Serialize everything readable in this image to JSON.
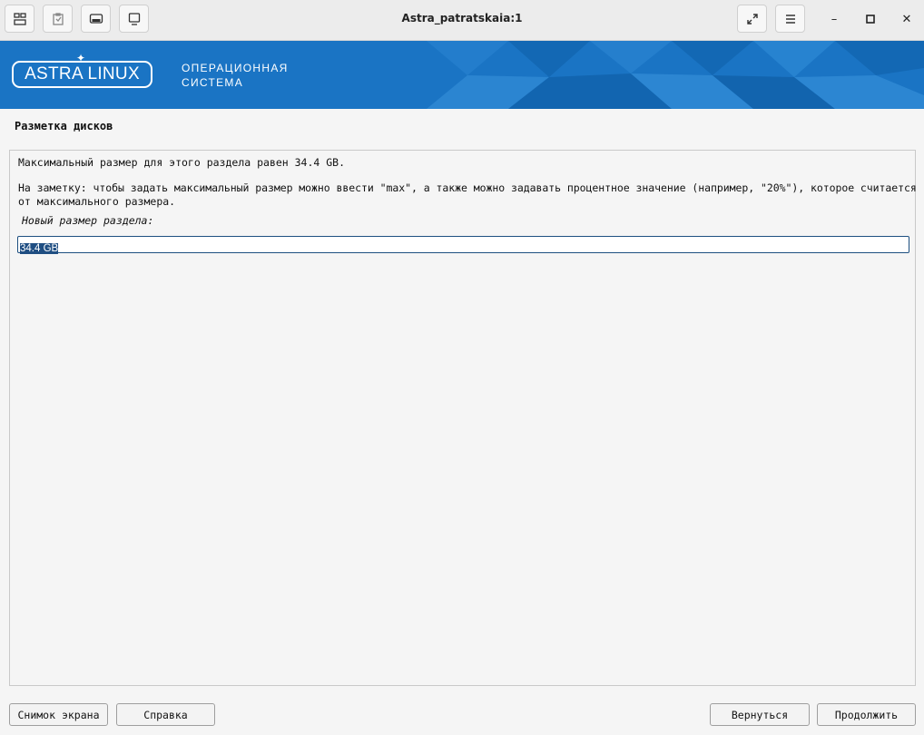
{
  "window": {
    "title": "Astra_patratskaia:1"
  },
  "toolbar": {
    "buttons": [
      {
        "icon": "windows-icon"
      },
      {
        "icon": "clipboard-icon"
      },
      {
        "icon": "keyboard-icon"
      },
      {
        "icon": "monitor-icon"
      }
    ],
    "right_buttons": [
      {
        "icon": "fullscreen-icon"
      },
      {
        "icon": "menu-icon"
      }
    ],
    "controls": {
      "minimize": "–",
      "maximize": "▫",
      "close": "✕"
    }
  },
  "banner": {
    "logo": "ASTRA LINUX",
    "subtitle_line1": "ОПЕРАЦИОННАЯ",
    "subtitle_line2": "СИСТЕМА",
    "color": "#1a74c4"
  },
  "page": {
    "heading": "Разметка дисков",
    "max_size_text": "Максимальный размер для этого раздела равен 34.4 GB.",
    "note_line1": "На заметку: чтобы задать максимальный размер можно ввести \"max\", а также можно задавать процентное значение (например, \"20%\"), которое считается",
    "note_line2": "от максимального размера.",
    "field_label": "Новый размер раздела:",
    "field_value": "34.4 GB"
  },
  "buttons": {
    "screenshot": "Снимок экрана",
    "help": "Справка",
    "back": "Вернуться",
    "continue": "Продолжить"
  }
}
